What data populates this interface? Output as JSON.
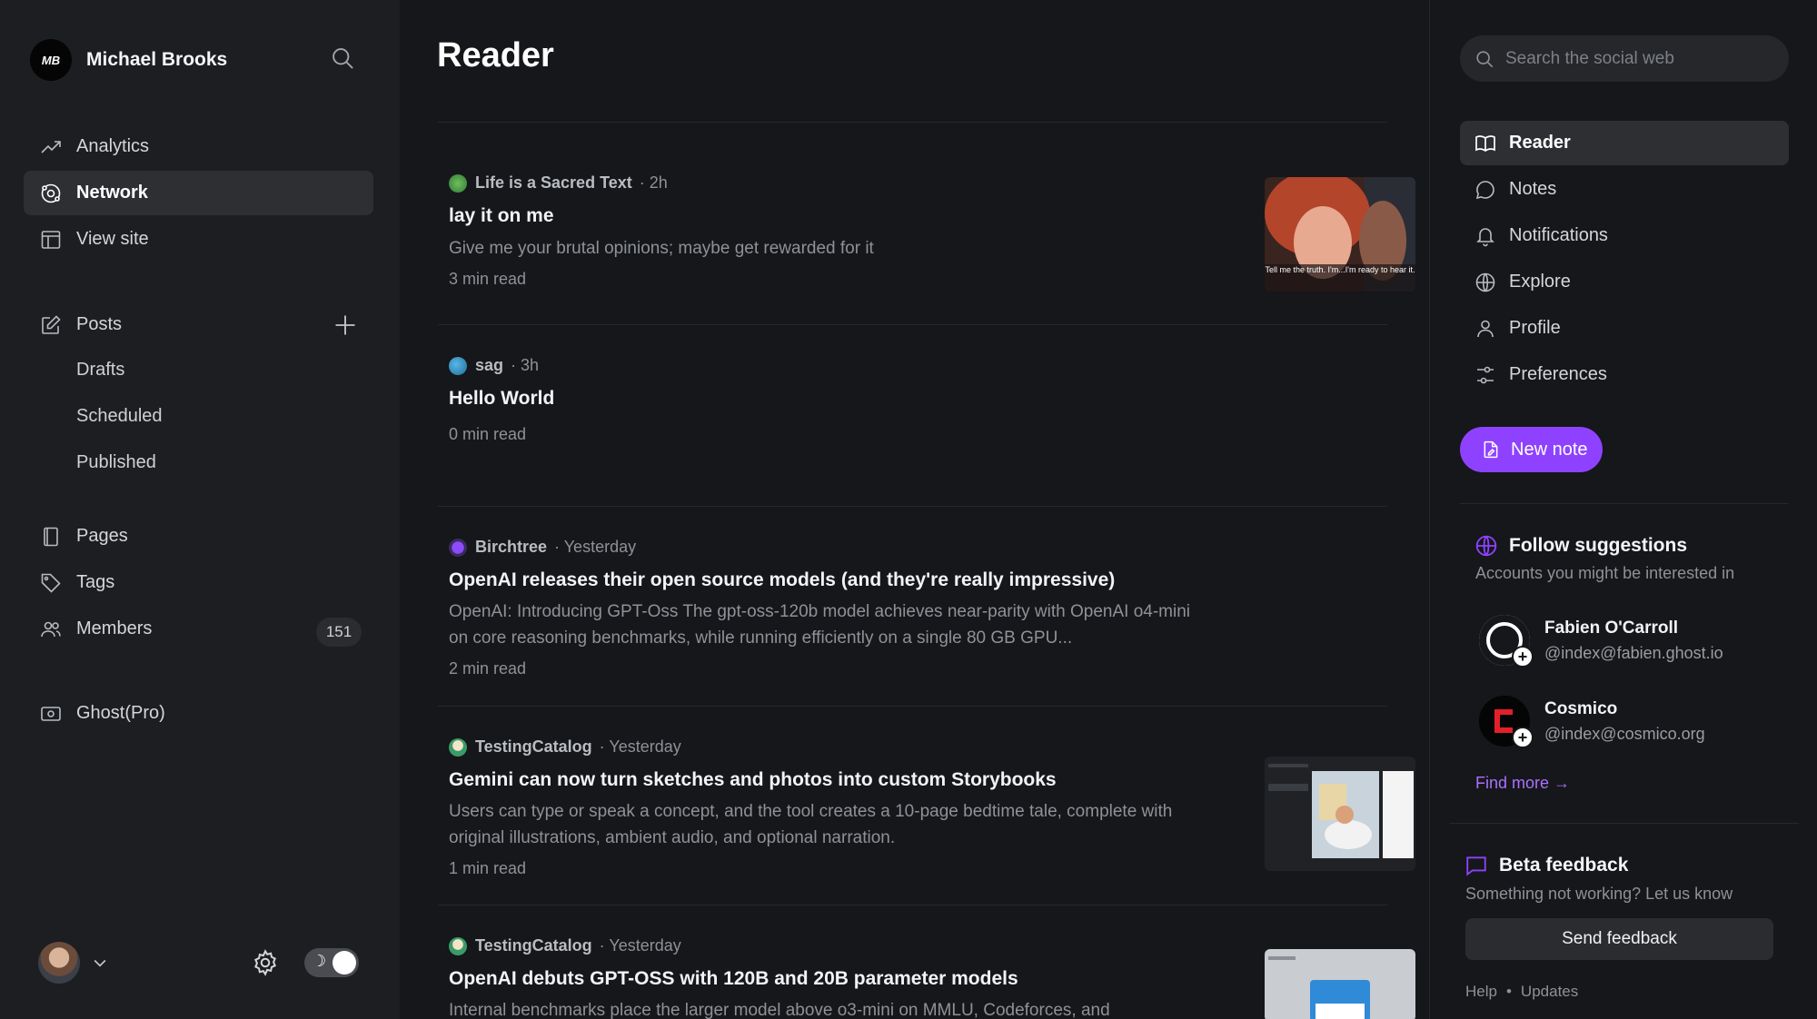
{
  "sidebar": {
    "brand_initials": "MB",
    "brand_name": "Michael Brooks",
    "nav": [
      {
        "label": "Analytics",
        "icon": "trend-icon"
      },
      {
        "label": "Network",
        "icon": "network-icon"
      },
      {
        "label": "View site",
        "icon": "layout-icon"
      }
    ],
    "posts": {
      "label": "Posts",
      "sub": [
        "Drafts",
        "Scheduled",
        "Published"
      ]
    },
    "content": [
      {
        "label": "Pages"
      },
      {
        "label": "Tags"
      },
      {
        "label": "Members",
        "count": "151"
      }
    ],
    "pro_label": "Ghost(Pro)",
    "theme_toggle_glyph": "☽"
  },
  "main": {
    "title": "Reader",
    "feed": [
      {
        "author": "Life is a Sacred Text",
        "time": "· 2h",
        "title": "lay it on me",
        "excerpt": "Give me your brutal opinions; maybe get rewarded for it",
        "read": "3 min read",
        "thumb_caption": "Tell me the truth. I'm...I'm ready to hear it."
      },
      {
        "author": "sag",
        "time": "· 3h",
        "title": "Hello World",
        "excerpt": "",
        "read": "0 min read"
      },
      {
        "author": "Birchtree",
        "time": "· Yesterday",
        "title": "OpenAI releases their open source models (and they're really impressive)",
        "excerpt": "OpenAI: Introducing GPT-Oss The gpt-oss-120b model achieves near-parity with OpenAI o4-mini on core reasoning benchmarks, while running efficiently on a single 80 GB GPU...",
        "read": "2 min read"
      },
      {
        "author": "TestingCatalog",
        "time": "· Yesterday",
        "title": "Gemini can now turn sketches and photos into custom Storybooks",
        "excerpt": "Users can type or speak a concept, and the tool creates a 10-page bedtime tale, complete with original illustrations, ambient audio, and optional narration.",
        "read": "1 min read"
      },
      {
        "author": "TestingCatalog",
        "time": "· Yesterday",
        "title": "OpenAI debuts GPT-OSS with 120B and 20B parameter models",
        "excerpt": "Internal benchmarks place the larger model above o3-mini on MMLU, Codeforces, and",
        "read": ""
      }
    ]
  },
  "right": {
    "search_placeholder": "Search the social web",
    "nav": [
      {
        "label": "Reader"
      },
      {
        "label": "Notes"
      },
      {
        "label": "Notifications"
      },
      {
        "label": "Explore"
      },
      {
        "label": "Profile"
      },
      {
        "label": "Preferences"
      }
    ],
    "new_note": "New note",
    "follow": {
      "title": "Follow suggestions",
      "subtitle": "Accounts you might be interested in",
      "users": [
        {
          "name": "Fabien O'Carroll",
          "handle": "@index@fabien.ghost.io"
        },
        {
          "name": "Cosmico",
          "handle": "@index@cosmico.org"
        }
      ],
      "find_more": "Find more →"
    },
    "beta": {
      "title": "Beta feedback",
      "subtitle": "Something not working? Let us know",
      "button": "Send feedback"
    },
    "footer": {
      "help": "Help",
      "sep": "•",
      "updates": "Updates"
    }
  },
  "colors": {
    "accent": "#8e42ff",
    "link": "#a971ff"
  }
}
